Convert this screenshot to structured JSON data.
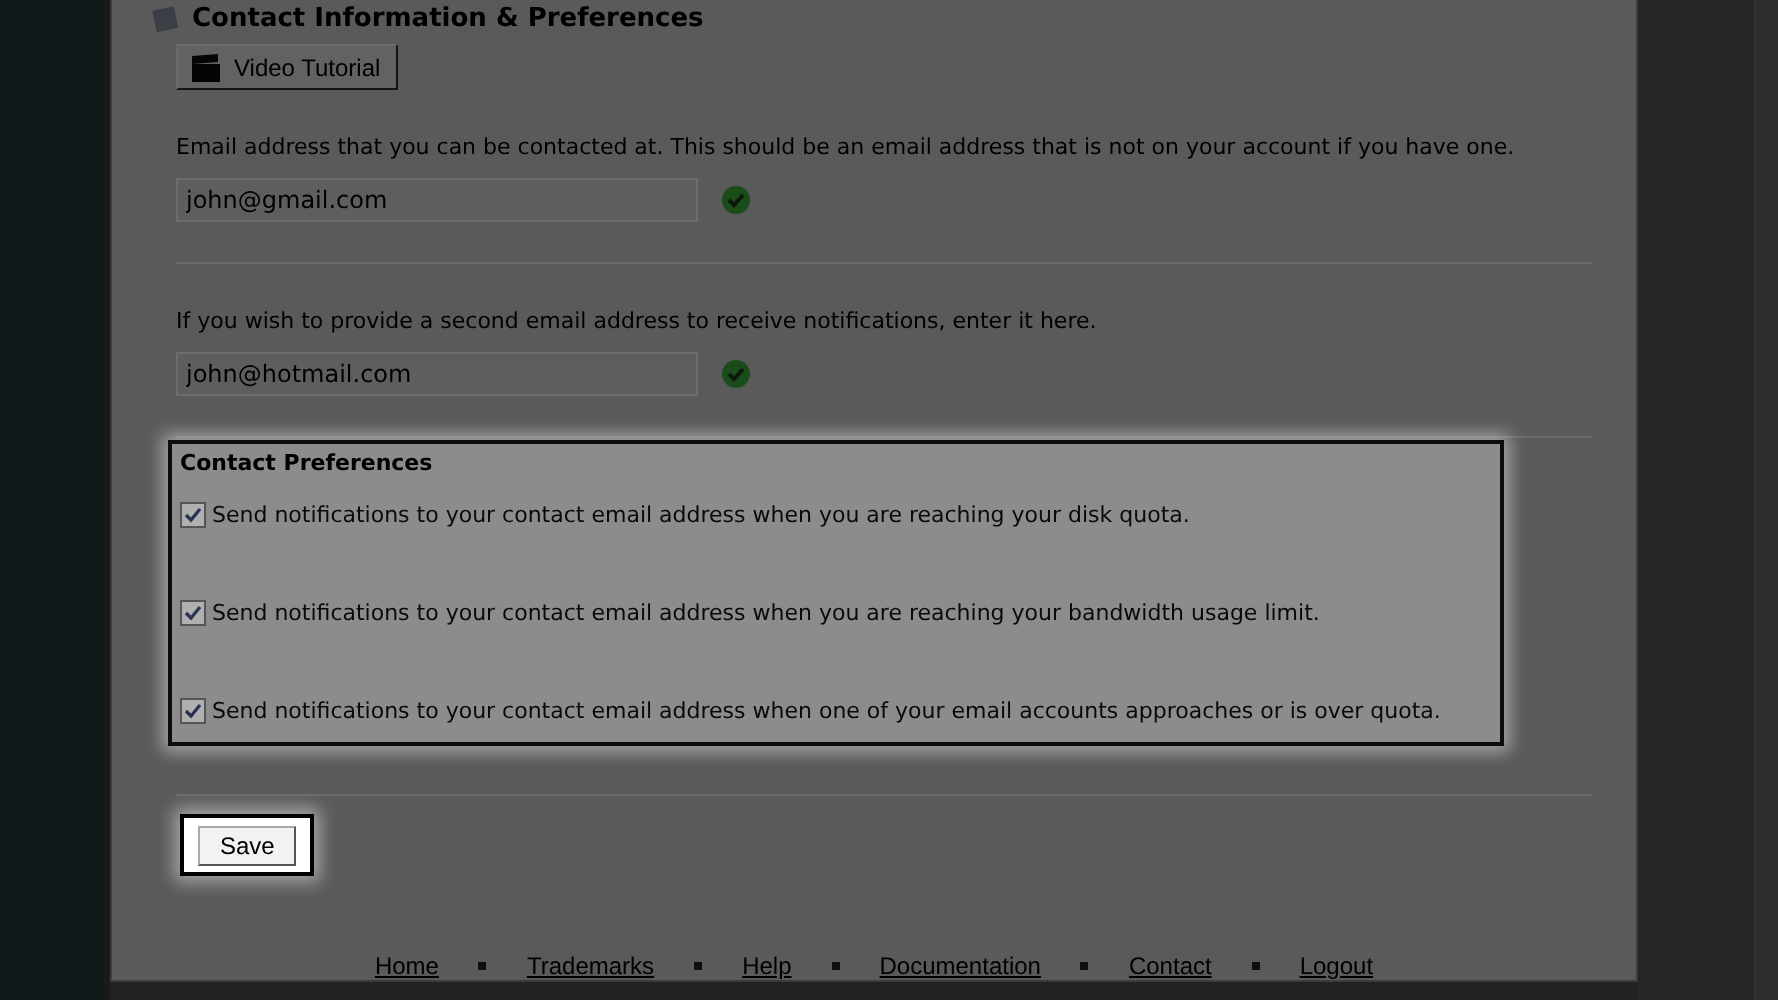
{
  "section": {
    "title": "Contact Information & Preferences",
    "video_button": "Video Tutorial"
  },
  "fields": [
    {
      "description": "Email address that you can be contacted at. This should be an email address that is not on your account if you have one.",
      "value": "john@gmail.com",
      "valid": true
    },
    {
      "description": "If you wish to provide a second email address to receive notifications, enter it here.",
      "value": "john@hotmail.com",
      "valid": true
    }
  ],
  "contact_preferences": {
    "title": "Contact Preferences",
    "options": [
      {
        "label": "Send notifications to your contact email address when you are reaching your disk quota.",
        "checked": true
      },
      {
        "label": "Send notifications to your contact email address when you are reaching your bandwidth usage limit.",
        "checked": true
      },
      {
        "label": "Send notifications to your contact email address when one of your email accounts approaches or is over quota.",
        "checked": true
      }
    ]
  },
  "save_button": "Save",
  "footer_links": [
    "Home",
    "Trademarks",
    "Help",
    "Documentation",
    "Contact",
    "Logout"
  ]
}
